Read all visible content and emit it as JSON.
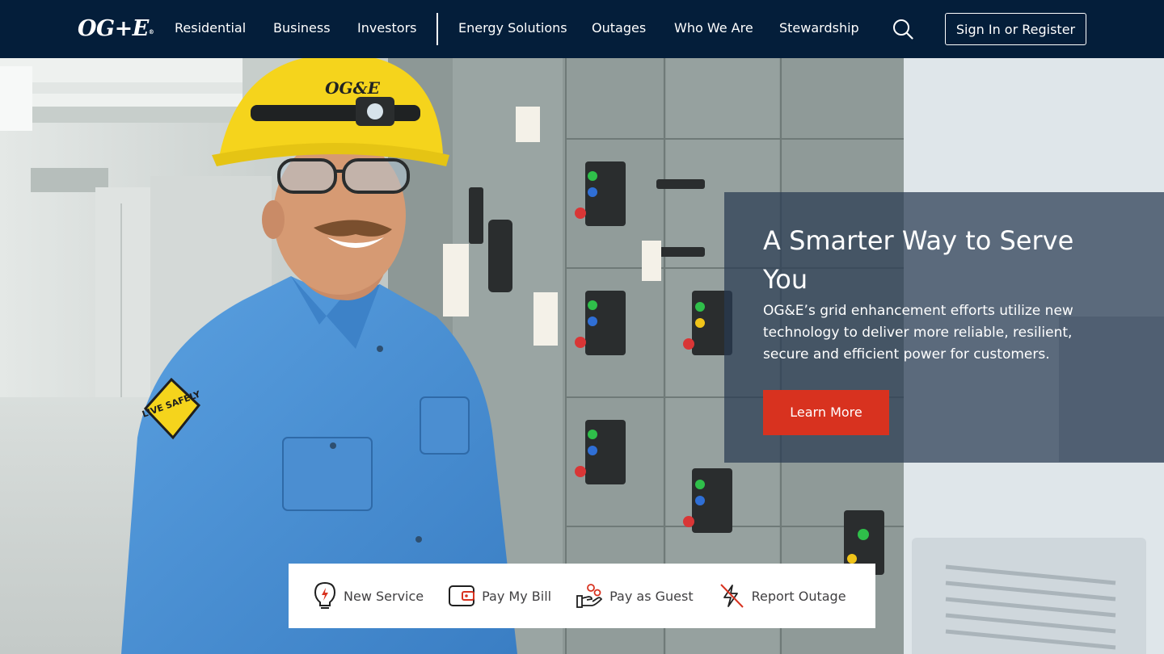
{
  "header": {
    "logo_text": "OG+E",
    "logo_mark": "®",
    "nav_left": [
      {
        "label": "Residential"
      },
      {
        "label": "Business"
      },
      {
        "label": "Investors"
      }
    ],
    "nav_right": [
      {
        "label": "Energy Solutions"
      },
      {
        "label": "Outages"
      },
      {
        "label": "Who We Are"
      },
      {
        "label": "Stewardship"
      }
    ],
    "search_icon": "search-icon",
    "signin_label": "Sign In or Register"
  },
  "hero": {
    "title": "A Smarter Way to Serve You",
    "body": "OG&E’s grid enhancement efforts utilize new technology to deliver more reliable, resilient, secure and efficient power for customers.",
    "cta_label": "Learn More",
    "helmet_text": "OG&E",
    "patch_text": "LIVE SAFELY"
  },
  "quick_links": [
    {
      "label": "New Service",
      "icon": "lightbulb-icon"
    },
    {
      "label": "Pay My Bill",
      "icon": "wallet-icon"
    },
    {
      "label": "Pay as Guest",
      "icon": "hand-coins-icon"
    },
    {
      "label": "Report Outage",
      "icon": "power-off-icon"
    }
  ],
  "colors": {
    "header_bg": "#041e3a",
    "accent_red": "#d8321f",
    "panel_bg": "rgba(40,58,82,0.72)",
    "shirt_blue": "#4a90d6",
    "helmet_yellow": "#f5d41c"
  }
}
